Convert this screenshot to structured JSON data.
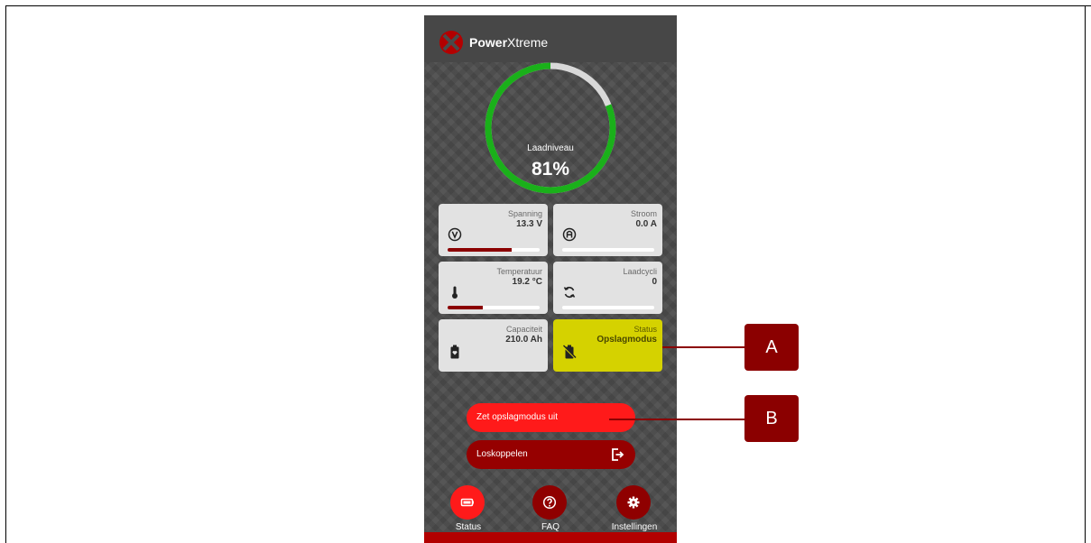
{
  "app": {
    "brand_bold": "Power",
    "brand_light": "Xtreme"
  },
  "gauge": {
    "label": "Laadniveau",
    "value_text": "81%",
    "value": 81,
    "color": "#1ab01a",
    "track_color": "#d9d9d9"
  },
  "tiles": [
    {
      "label": "Spanning",
      "value": "13.3 V",
      "icon": "volt-icon",
      "bar_level": 0.7
    },
    {
      "label": "Stroom",
      "value": "0.0 A",
      "icon": "ampere-icon",
      "bar_level": 0.0
    },
    {
      "label": "Temperatuur",
      "value": "19.2 °C",
      "icon": "thermometer-icon",
      "bar_level": 0.38
    },
    {
      "label": "Laadcycli",
      "value": "0",
      "icon": "cycle-icon",
      "bar_level": 0.0
    },
    {
      "label": "Capaciteit",
      "value": "210.0 Ah",
      "icon": "battery-icon"
    },
    {
      "label": "Status",
      "value": "Opslagmodus",
      "icon": "battery-off-icon"
    }
  ],
  "buttons": {
    "storage_off": "Zet opslagmodus uit",
    "disconnect": "Loskoppelen"
  },
  "nav": [
    {
      "label": "Status",
      "icon": "battery-icon",
      "active": true
    },
    {
      "label": "FAQ",
      "icon": "help-icon",
      "active": false
    },
    {
      "label": "Instellingen",
      "icon": "gear-icon",
      "active": false
    }
  ],
  "callouts": {
    "a": "A",
    "b": "B"
  },
  "colors": {
    "accent_red": "#ff1a1a",
    "dark_red": "#8b0000",
    "status_yellow": "#d5d200",
    "gauge_green": "#1ab01a"
  }
}
